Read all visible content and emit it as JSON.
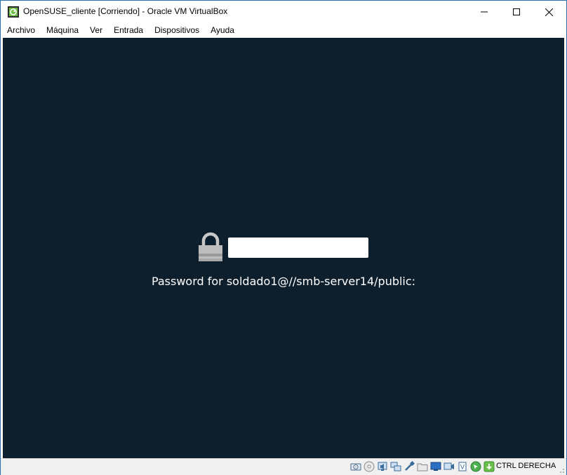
{
  "window": {
    "title": "OpenSUSE_cliente [Corriendo] - Oracle VM VirtualBox",
    "controls": {
      "minimize": "minimize-icon",
      "maximize": "maximize-icon",
      "close": "close-icon"
    }
  },
  "menu": {
    "items": [
      "Archivo",
      "Máquina",
      "Ver",
      "Entrada",
      "Dispositivos",
      "Ayuda"
    ]
  },
  "guest": {
    "background_color": "#0d1f2d",
    "lock_icon": "lock-icon",
    "password_field": {
      "value": "",
      "placeholder": ""
    },
    "prompt": "Password for soldado1@//smb-server14/public:"
  },
  "statusbar": {
    "icons": [
      "hard-disk-icon",
      "optical-drive-icon",
      "audio-icon",
      "network-icon",
      "usb-icon",
      "shared-folders-icon",
      "display-icon",
      "video-capture-icon",
      "cpu-icon",
      "mouse-integration-icon",
      "keyboard-icon"
    ],
    "host_key": "CTRL DERECHA"
  },
  "colors": {
    "accent": "#2b6fb6",
    "screen": "#0d1f2d",
    "statusbar": "#f0f0f0"
  }
}
